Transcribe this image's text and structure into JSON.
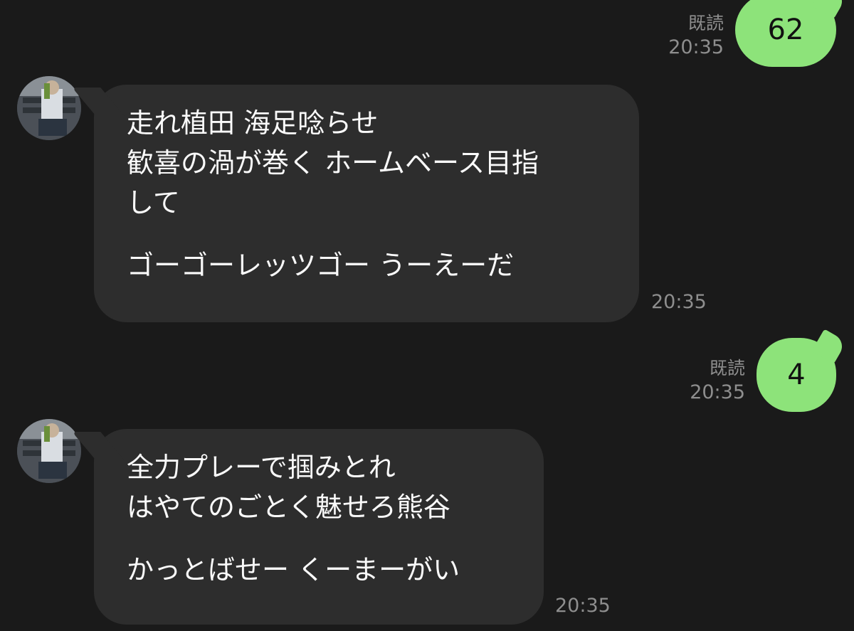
{
  "messages": [
    {
      "direction": "out",
      "text": "62",
      "read_label": "既読",
      "time": "20:35"
    },
    {
      "direction": "in",
      "lines": [
        "走れ植田 海足唸らせ",
        "歓喜の渦が巻く ホームベース目指",
        "して",
        "ゴーゴーレッツゴー うーえーだ"
      ],
      "time": "20:35"
    },
    {
      "direction": "out",
      "text": "4",
      "read_label": "既読",
      "time": "20:35"
    },
    {
      "direction": "in",
      "lines": [
        "全力プレーで掴みとれ",
        "はやてのごとく魅せろ熊谷",
        "かっとばせー くーまーがい"
      ],
      "time": "20:35"
    }
  ],
  "colors": {
    "background": "#1a1a1a",
    "outgoing_bubble": "#8de37a",
    "incoming_bubble": "#2d2d2d",
    "meta_text": "#8e8e8e"
  }
}
